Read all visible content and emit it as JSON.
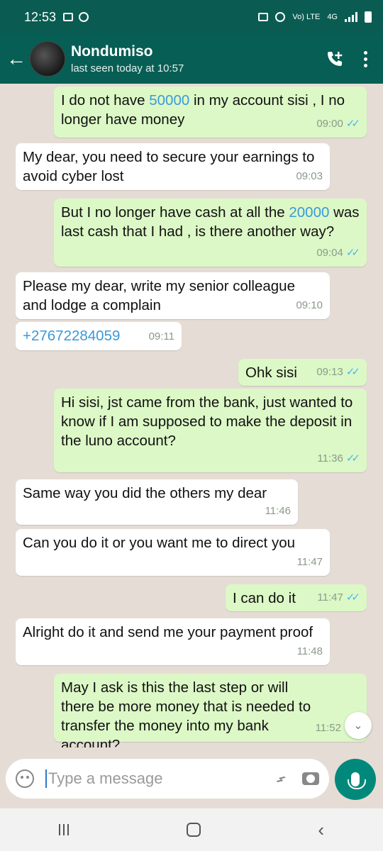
{
  "status_bar": {
    "time": "12:53",
    "network": "Vo) LTE",
    "net_gen": "4G"
  },
  "header": {
    "contact_name": "Nondumiso",
    "last_seen": "last seen today at 10:57"
  },
  "messages": [
    {
      "dir": "out",
      "parts": [
        "I do not have ",
        "50000",
        " in my account sisi , I no longer have money"
      ],
      "time": "09:00",
      "ticks": "✓✓"
    },
    {
      "dir": "in",
      "text": "My dear, you need to secure your earnings to avoid cyber lost",
      "time": "09:03"
    },
    {
      "dir": "out",
      "parts": [
        "But I no longer have cash at all the ",
        "20000",
        " was last cash that I had , is there another way?"
      ],
      "time": "09:04",
      "ticks": "✓✓"
    },
    {
      "dir": "in",
      "text": "Please my dear, write my senior colleague and lodge a complain",
      "time": "09:10"
    },
    {
      "dir": "in",
      "text": "+27672284059",
      "time": "09:11",
      "link": true
    },
    {
      "dir": "out",
      "text": "Ohk sisi",
      "time": "09:13",
      "ticks": "✓✓"
    },
    {
      "dir": "out",
      "text": "Hi sisi, jst came from the bank, just wanted to know if I am supposed to make the deposit in the luno account?",
      "time": "11:36",
      "ticks": "✓✓"
    },
    {
      "dir": "in",
      "text": "Same way you did the others my dear",
      "time": "11:46"
    },
    {
      "dir": "in",
      "text": "Can you do it or you want me to direct you",
      "time": "11:47"
    },
    {
      "dir": "out",
      "text": "I can do it",
      "time": "11:47",
      "ticks": "✓✓"
    },
    {
      "dir": "in",
      "text": "Alright do it and send me your payment proof",
      "time": "11:48"
    },
    {
      "dir": "out",
      "text": "May I ask is this the last step or will there be more money that is needed to transfer the money into my bank account?",
      "time": "11:52"
    }
  ],
  "composer": {
    "placeholder": "Type a message"
  },
  "colors": {
    "header": "#075e54",
    "status_bar": "#0a5c52",
    "outgoing": "#dcf8c6",
    "incoming": "#ffffff",
    "accent": "#00897b",
    "link": "#3b9ad9"
  },
  "icons": [
    "back-arrow-icon",
    "add-call-icon",
    "more-options-icon",
    "emoji-icon",
    "attach-icon",
    "camera-icon",
    "mic-icon",
    "scroll-down-icon"
  ]
}
